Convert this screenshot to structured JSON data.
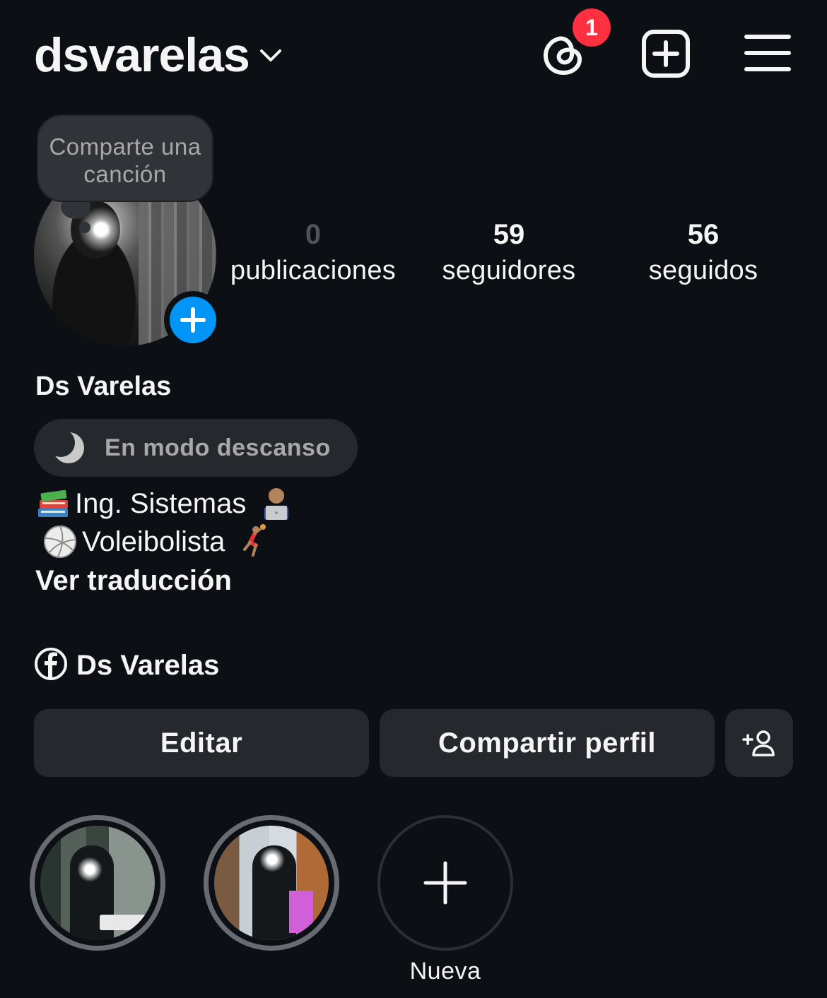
{
  "header": {
    "username": "dsvarelas",
    "threads_badge_count": "1",
    "icons": [
      "chevron-down-icon",
      "threads-icon",
      "create-icon",
      "menu-icon"
    ]
  },
  "profile": {
    "tooltip": "Comparte una canción",
    "display_name": "Ds Varelas",
    "status": "En modo descanso"
  },
  "stats": {
    "posts": {
      "value": "0",
      "label": "publicaciones"
    },
    "followers": {
      "value": "59",
      "label": "seguidores"
    },
    "following": {
      "value": "56",
      "label": "seguidos"
    }
  },
  "bio": {
    "line1": "Ing. Sistemas",
    "line2": "Voleibolista",
    "see_translation": "Ver traducción"
  },
  "facebook": {
    "name": "Ds Varelas"
  },
  "buttons": {
    "edit": "Editar",
    "share": "Compartir perfil"
  },
  "highlights": {
    "new_label": "Nueva"
  },
  "colors": {
    "background": "#0c1014",
    "badge": "#ff3040",
    "accent_blue": "#0095f6",
    "button_bg": "#25292e"
  }
}
